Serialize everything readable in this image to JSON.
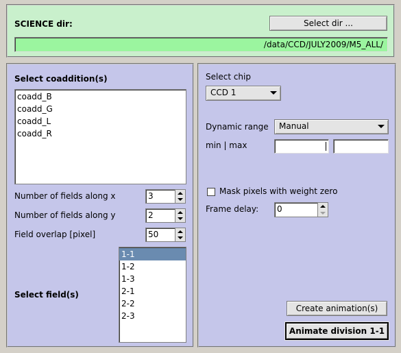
{
  "top": {
    "science_label": "SCIENCE dir:",
    "select_dir_button": "Select dir ...",
    "path_value": "/data/CCD/JULY2009/M5_ALL/"
  },
  "left": {
    "coadd_heading": "Select coaddition(s)",
    "coadd_items": [
      "coadd_B",
      "coadd_G",
      "coadd_L",
      "coadd_R"
    ],
    "fields_x_label": "Number of fields along x",
    "fields_x_value": "3",
    "fields_y_label": "Number of fields along y",
    "fields_y_value": "2",
    "overlap_label": "Field overlap [pixel]",
    "overlap_value": "50",
    "field_heading": "Select field(s)",
    "field_items": [
      "1-1",
      "1-2",
      "1-3",
      "2-1",
      "2-2",
      "2-3"
    ],
    "selected_field": "1-1"
  },
  "right": {
    "select_chip_label": "Select chip",
    "chip_value": "CCD 1",
    "dynamic_range_label": "Dynamic range",
    "dynamic_range_value": "Manual",
    "minmax_label": "min | max",
    "min_value": "",
    "max_value": "",
    "mask_label": "Mask pixels with weight zero",
    "mask_checked": false,
    "frame_delay_label": "Frame delay:",
    "frame_delay_value": "0",
    "create_button": "Create animation(s)",
    "animate_button": "Animate division 1-1"
  },
  "colors": {
    "top_bg": "#c9f0cc",
    "path_field_bg": "#9bf59f",
    "panel_bg": "#c5c6ea",
    "selection_bg": "#6a8bb0"
  }
}
